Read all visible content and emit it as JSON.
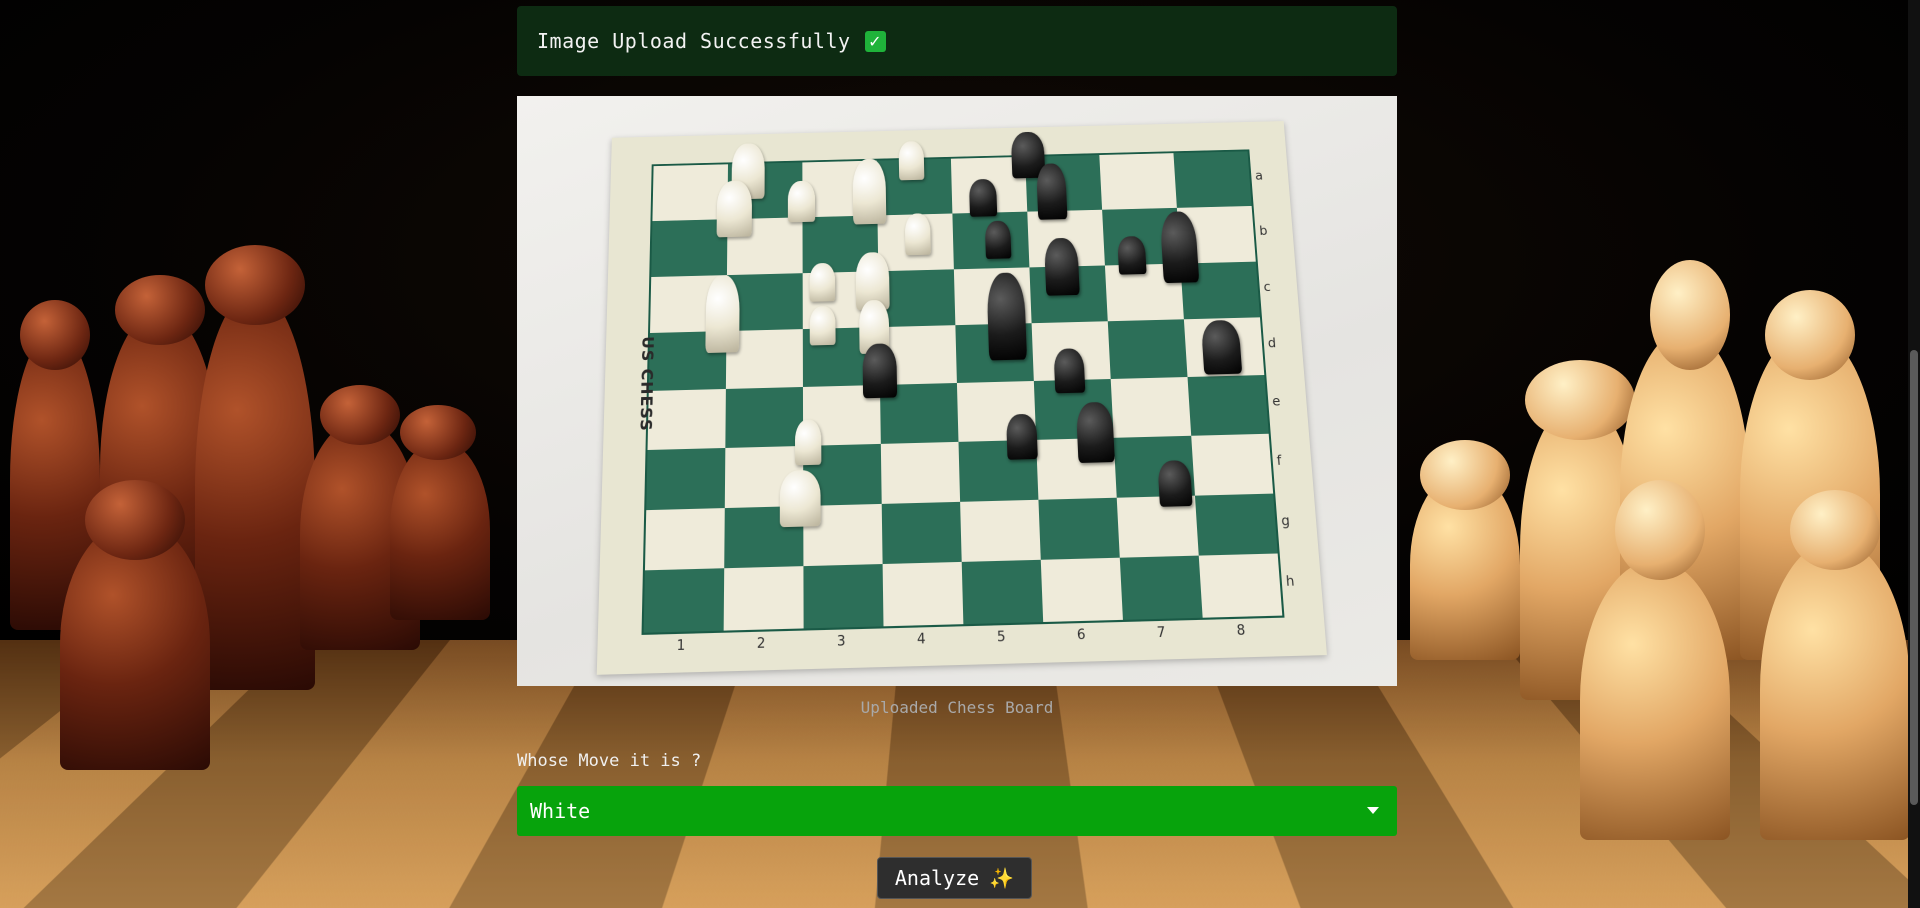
{
  "alert": {
    "text": "Image Upload Successfully",
    "icon": "check-mark-icon",
    "icon_glyph": "✓"
  },
  "image": {
    "caption": "Uploaded Chess Board",
    "board": {
      "brand": "US CHESS",
      "files": [
        "1",
        "2",
        "3",
        "4",
        "5",
        "6",
        "7",
        "8"
      ],
      "ranks": [
        "a",
        "b",
        "c",
        "d",
        "e",
        "f",
        "g",
        "h"
      ]
    }
  },
  "form": {
    "label": "Whose Move it is ?",
    "selected_value": "White",
    "select_icon": "chevron-down-icon"
  },
  "analyze_button": {
    "label": "Analyze",
    "icon": "sparkles-icon",
    "icon_glyph": "✨"
  },
  "colors": {
    "alert_bg": "#0d2b12",
    "select_bg": "#07a30c",
    "button_bg": "#2e2e2e",
    "board_green": "#2c6f58"
  }
}
